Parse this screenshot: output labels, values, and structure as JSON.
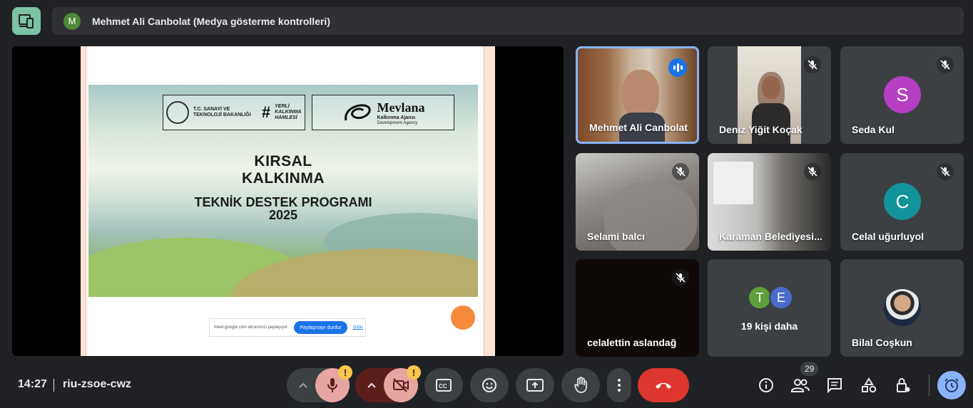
{
  "topbar": {
    "presenter_initial": "M",
    "title": "Mehmet Ali Canbolat (Medya gösterme kontrolleri)"
  },
  "slide": {
    "logo_left_text": "T.C. SANAYİ VE TEKNOLOJİ BAKANLIĞI",
    "logo_hash_text": "YERLİ KALKINMA HAMLESİ",
    "logo_right_title": "Mevlana",
    "logo_right_sub": "Kalkınma Ajansı",
    "logo_right_sub2": "Development Agency",
    "title_line1": "KIRSAL",
    "title_line2": "KALKINMA",
    "subtitle_line1": "TEKNİK DESTEK PROGRAMI",
    "subtitle_line2": "2025",
    "share_text": "meet.google.com ekranınızı paylaşıyor.",
    "share_stop_label": "Paylaşmayı durdur",
    "share_hide_label": "Gizle"
  },
  "participants": [
    {
      "name": "Mehmet Ali Canbolat",
      "status": "speaking"
    },
    {
      "name": "Deniz Yiğit Koçak",
      "status": "muted"
    },
    {
      "name": "Seda Kul",
      "status": "muted",
      "initial": "S",
      "color": "#b63fc4"
    },
    {
      "name": "Selami balcı",
      "status": "muted"
    },
    {
      "name": "Karaman Belediyesi...",
      "status": "muted"
    },
    {
      "name": "Celal uğurluyol",
      "status": "muted",
      "initial": "C",
      "color": "#12939a"
    },
    {
      "name": "celalettin aslandağ",
      "status": "muted"
    },
    {
      "name": "Bilal Coşkun"
    }
  ],
  "more": {
    "initial1": "T",
    "color1": "#5f9f3b",
    "initial2": "E",
    "color2": "#4b6bcb",
    "label": "19 kişi daha"
  },
  "bottombar": {
    "time": "14:27",
    "meeting_code": "riu-zsoe-cwz",
    "warning_mark": "!",
    "people_count": "29"
  },
  "colors": {
    "end_call": "#dc362e",
    "muted_control": "#e6a5a2",
    "accent": "#8ab4f8"
  }
}
